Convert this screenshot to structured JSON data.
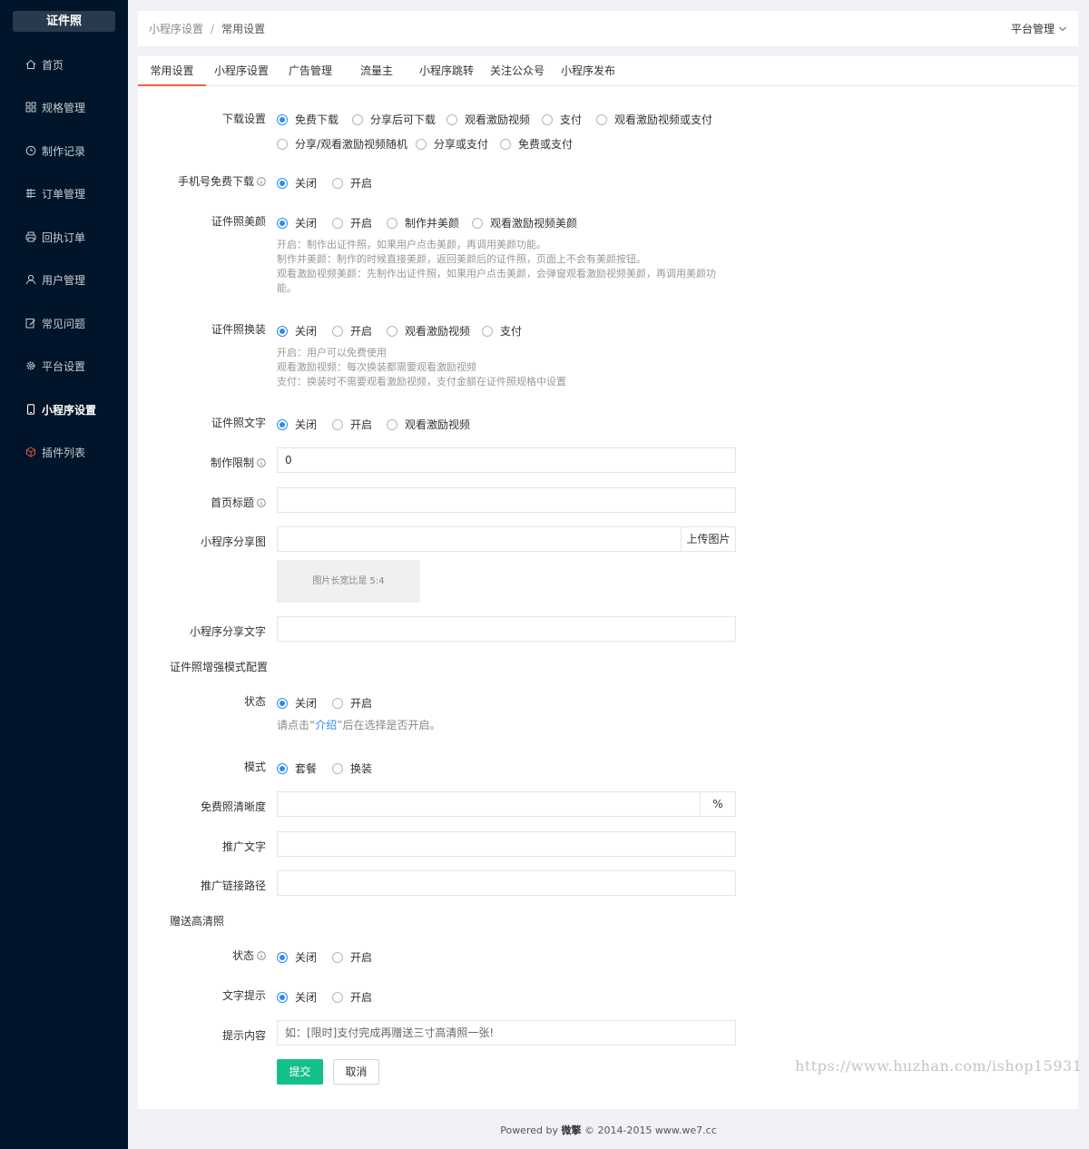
{
  "app": {
    "logo": "证件照"
  },
  "sidebar": {
    "items": [
      {
        "label": "首页",
        "icon": "home-icon"
      },
      {
        "label": "规格管理",
        "icon": "grid-icon"
      },
      {
        "label": "制作记录",
        "icon": "clock-icon"
      },
      {
        "label": "订单管理",
        "icon": "list-icon"
      },
      {
        "label": "回执订单",
        "icon": "printer-icon"
      },
      {
        "label": "用户管理",
        "icon": "user-icon"
      },
      {
        "label": "常见问题",
        "icon": "edit-icon"
      },
      {
        "label": "平台设置",
        "icon": "gear-icon"
      },
      {
        "label": "小程序设置",
        "icon": "phone-icon",
        "active": true
      },
      {
        "label": "插件列表",
        "icon": "cube-icon"
      }
    ]
  },
  "header": {
    "breadcrumb": [
      "小程序设置",
      "常用设置"
    ],
    "separator": "/",
    "platform": "平台管理"
  },
  "tabs": [
    "常用设置",
    "小程序设置",
    "广告管理",
    "流量主",
    "小程序跳转",
    "关注公众号",
    "小程序发布"
  ],
  "form": {
    "download": {
      "label": "下载设置",
      "options": [
        "免费下载",
        "分享后可下载",
        "观看激励视频",
        "支付",
        "观看激励视频或支付",
        "分享/观看激励视频随机",
        "分享或支付",
        "免费或支付"
      ],
      "selected": "免费下载"
    },
    "phone_free": {
      "label": "手机号免费下载",
      "options": [
        "关闭",
        "开启"
      ],
      "selected": "关闭"
    },
    "beauty": {
      "label": "证件照美颜",
      "options": [
        "关闭",
        "开启",
        "制作并美颜",
        "观看激励视频美颜"
      ],
      "selected": "关闭",
      "help": [
        "开启：制作出证件照，如果用户点击美颜，再调用美颜功能。",
        "制作并美颜：制作的时候直接美颜，返回美颜后的证件照，页面上不会有美颜按钮。",
        "观看激励视频美颜：先制作出证件照，如果用户点击美颜，会弹窗观看激励视频美颜，再调用美颜功",
        "能。"
      ]
    },
    "outfit": {
      "label": "证件照换装",
      "options": [
        "关闭",
        "开启",
        "观看激励视频",
        "支付"
      ],
      "selected": "关闭",
      "help": [
        "开启：用户可以免费使用",
        "观看激励视频：每次换装都需要观看激励视频",
        "支付：换装时不需要观看激励视频，支付金额在证件照规格中设置"
      ]
    },
    "text": {
      "label": "证件照文字",
      "options": [
        "关闭",
        "开启",
        "观看激励视频"
      ],
      "selected": "关闭"
    },
    "limit": {
      "label": "制作限制",
      "value": "0"
    },
    "home_title": {
      "label": "首页标题",
      "value": ""
    },
    "share_image": {
      "label": "小程序分享图",
      "value": "",
      "button": "上传图片",
      "hint": "图片长宽比是 5:4"
    },
    "share_text": {
      "label": "小程序分享文字",
      "value": ""
    },
    "enhanced": {
      "title": "证件照增强模式配置",
      "status": {
        "label": "状态",
        "options": [
          "关闭",
          "开启"
        ],
        "selected": "关闭"
      },
      "help_pre": "请点击“",
      "help_link": "介绍",
      "help_post": "”后在选择是否开启。",
      "mode": {
        "label": "模式",
        "options": [
          "套餐",
          "换装"
        ],
        "selected": "套餐"
      },
      "free_clarity": {
        "label": "免费照清晰度",
        "value": "",
        "suffix": "%"
      },
      "promo_text": {
        "label": "推广文字",
        "value": ""
      },
      "promo_link": {
        "label": "推广链接路径",
        "value": ""
      }
    },
    "gift": {
      "title": "赠送高清照",
      "status": {
        "label": "状态",
        "options": [
          "关闭",
          "开启"
        ],
        "selected": "关闭"
      },
      "tip": {
        "label": "文字提示",
        "options": [
          "关闭",
          "开启"
        ],
        "selected": "关闭"
      },
      "content": {
        "label": "提示内容",
        "placeholder": "如：[限时]支付完成再赠送三寸高清照一张!"
      }
    },
    "submit": "提交",
    "cancel": "取消"
  },
  "watermark": "https://www.huzhan.com/ishop15931",
  "footer": {
    "prefix": "Powered by",
    "brand": "微擎",
    "suffix": "© 2014-2015 www.we7.cc"
  },
  "colors": {
    "sidebar": "#001529",
    "primary": "#13c08c",
    "radio": "#2d8cf0",
    "tab_active": "#e8663c"
  }
}
